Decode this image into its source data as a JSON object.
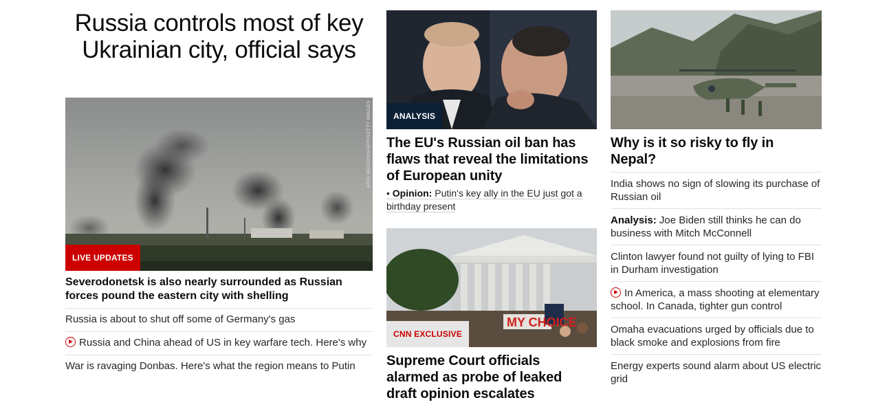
{
  "left": {
    "lead_title": "Russia controls most of key Ukrainian city, official says",
    "badge": "LIVE UPDATES",
    "photo_credit": "ARIS MESSINIS/AFP/GETTY IMAGES",
    "headline": "Severodonetsk is also nearly surrounded as Russian forces pound the eastern city with shelling",
    "links": [
      {
        "text": "Russia is about to shut off some of Germany's gas",
        "video": false
      },
      {
        "text": "Russia and China ahead of US in key warfare tech. Here's why",
        "video": true
      },
      {
        "text": "War is ravaging Donbas. Here's what the region means to Putin",
        "video": false
      }
    ]
  },
  "middle": {
    "top_badge": "ANALYSIS",
    "top_headline": "The EU's Russian oil ban has flaws that reveal the limitations of European unity",
    "opinion_prefix": "Opinion:",
    "opinion_text": "Putin's key ally in the EU just got a birthday present",
    "bottom_badge": "CNN EXCLUSIVE",
    "bottom_headline": "Supreme Court officials alarmed as probe of leaked draft opinion escalates",
    "protest_sign": "MY CHOICE"
  },
  "right": {
    "headline": "Why is it so risky to fly in Nepal?",
    "links": [
      {
        "prefix": "",
        "text": "India shows no sign of slowing its purchase of Russian oil",
        "video": false
      },
      {
        "prefix": "Analysis:",
        "text": "Joe Biden still thinks he can do business with Mitch McConnell",
        "video": false
      },
      {
        "prefix": "",
        "text": "Clinton lawyer found not guilty of lying to FBI in Durham investigation",
        "video": false
      },
      {
        "prefix": "",
        "text": "In America, a mass shooting at elementary school. In Canada, tighter gun control",
        "video": true
      },
      {
        "prefix": "",
        "text": "Omaha evacuations urged by officials due to black smoke and explosions from fire",
        "video": false
      },
      {
        "prefix": "",
        "text": "Energy experts sound alarm about US electric grid",
        "video": false
      }
    ]
  },
  "colors": {
    "live_red": "#cc0000",
    "analysis_navy": "#0c1f35",
    "divider": "#e0e0e0"
  }
}
